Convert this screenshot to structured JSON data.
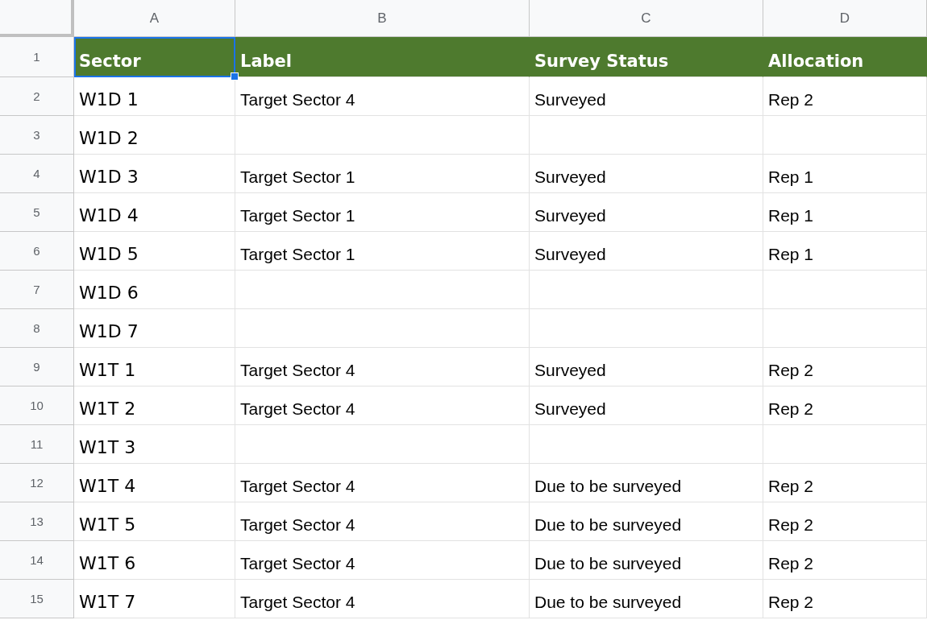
{
  "columns": [
    "A",
    "B",
    "C",
    "D"
  ],
  "rows": [
    {
      "number": "1",
      "header": true,
      "cells": [
        {
          "text": "Sector",
          "selected": true
        },
        {
          "text": "Label",
          "selected": false
        },
        {
          "text": "Survey Status",
          "selected": false
        },
        {
          "text": "Allocation",
          "selected": false
        }
      ]
    },
    {
      "number": "2",
      "header": false,
      "cells": [
        {
          "text": "W1D 1",
          "selected": false
        },
        {
          "text": "Target Sector 4",
          "selected": false
        },
        {
          "text": "Surveyed",
          "selected": false
        },
        {
          "text": "Rep 2",
          "selected": false
        }
      ]
    },
    {
      "number": "3",
      "header": false,
      "cells": [
        {
          "text": "W1D 2",
          "selected": false
        },
        {
          "selected": false
        },
        {
          "selected": false
        },
        {
          "selected": false
        }
      ]
    },
    {
      "number": "4",
      "header": false,
      "cells": [
        {
          "text": "W1D 3",
          "selected": false
        },
        {
          "text": "Target Sector 1",
          "selected": false
        },
        {
          "text": "Surveyed",
          "selected": false
        },
        {
          "text": "Rep 1",
          "selected": false
        }
      ]
    },
    {
      "number": "5",
      "header": false,
      "cells": [
        {
          "text": "W1D 4",
          "selected": false
        },
        {
          "text": "Target Sector 1",
          "selected": false
        },
        {
          "text": "Surveyed",
          "selected": false
        },
        {
          "text": "Rep 1",
          "selected": false
        }
      ]
    },
    {
      "number": "6",
      "header": false,
      "cells": [
        {
          "text": "W1D 5",
          "selected": false
        },
        {
          "text": "Target Sector 1",
          "selected": false
        },
        {
          "text": "Surveyed",
          "selected": false
        },
        {
          "text": "Rep 1",
          "selected": false
        }
      ]
    },
    {
      "number": "7",
      "header": false,
      "cells": [
        {
          "text": "W1D 6",
          "selected": false
        },
        {
          "selected": false
        },
        {
          "selected": false
        },
        {
          "selected": false
        }
      ]
    },
    {
      "number": "8",
      "header": false,
      "cells": [
        {
          "text": "W1D 7",
          "selected": false
        },
        {
          "selected": false
        },
        {
          "selected": false
        },
        {
          "selected": false
        }
      ]
    },
    {
      "number": "9",
      "header": false,
      "cells": [
        {
          "text": "W1T 1",
          "selected": false
        },
        {
          "text": "Target Sector 4",
          "selected": false
        },
        {
          "text": "Surveyed",
          "selected": false
        },
        {
          "text": "Rep 2",
          "selected": false
        }
      ]
    },
    {
      "number": "10",
      "header": false,
      "cells": [
        {
          "text": "W1T 2",
          "selected": false
        },
        {
          "text": "Target Sector 4",
          "selected": false
        },
        {
          "text": "Surveyed",
          "selected": false
        },
        {
          "text": "Rep 2",
          "selected": false
        }
      ]
    },
    {
      "number": "11",
      "header": false,
      "cells": [
        {
          "text": "W1T 3",
          "selected": false
        },
        {
          "selected": false
        },
        {
          "selected": false
        },
        {
          "selected": false
        }
      ]
    },
    {
      "number": "12",
      "header": false,
      "cells": [
        {
          "text": "W1T 4",
          "selected": false
        },
        {
          "text": "Target Sector 4",
          "selected": false
        },
        {
          "text": "Due to be surveyed",
          "selected": false
        },
        {
          "text": "Rep 2",
          "selected": false
        }
      ]
    },
    {
      "number": "13",
      "header": false,
      "cells": [
        {
          "text": "W1T 5",
          "selected": false
        },
        {
          "text": "Target Sector 4",
          "selected": false
        },
        {
          "text": "Due to be surveyed",
          "selected": false
        },
        {
          "text": "Rep 2",
          "selected": false
        }
      ]
    },
    {
      "number": "14",
      "header": false,
      "cells": [
        {
          "text": "W1T 6",
          "selected": false
        },
        {
          "text": "Target Sector 4",
          "selected": false
        },
        {
          "text": "Due to be surveyed",
          "selected": false
        },
        {
          "text": "Rep 2",
          "selected": false
        }
      ]
    },
    {
      "number": "15",
      "header": false,
      "cells": [
        {
          "text": "W1T 7",
          "selected": false
        },
        {
          "text": "Target Sector 4",
          "selected": false
        },
        {
          "text": "Due to be surveyed",
          "selected": false
        },
        {
          "text": "Rep 2",
          "selected": false
        }
      ]
    }
  ]
}
